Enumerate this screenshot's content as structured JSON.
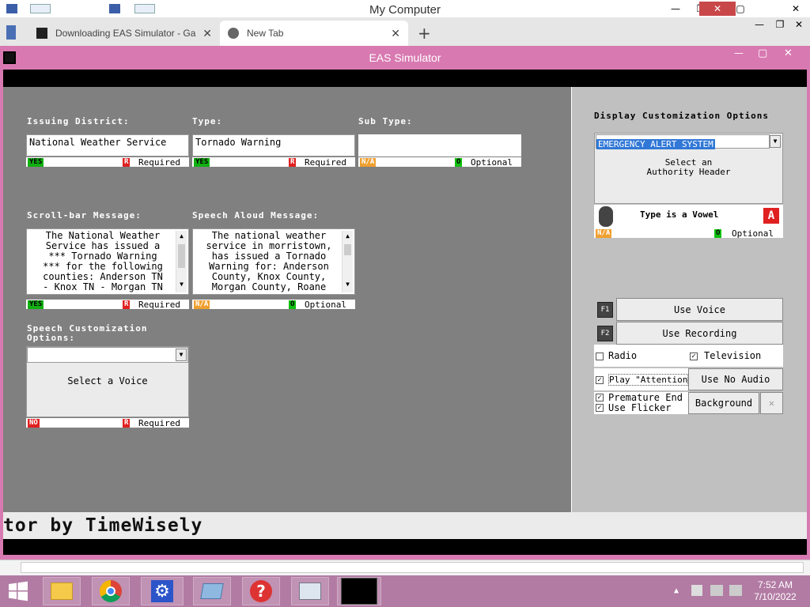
{
  "outer_window": {
    "title": "My Computer"
  },
  "browser": {
    "tabs": [
      {
        "label": "Downloading EAS Simulator - Ga",
        "icon": "download-page-icon"
      },
      {
        "label": "New Tab",
        "icon": "chrome-icon"
      }
    ]
  },
  "app": {
    "title": "EAS Simulator",
    "issuing_district": {
      "label": "Issuing District:",
      "value": "National Weather Service",
      "status": "YES",
      "flag": "R",
      "requirement": "Required"
    },
    "type": {
      "label": "Type:",
      "value": "Tornado Warning",
      "status": "YES",
      "flag": "R",
      "requirement": "Required"
    },
    "sub_type": {
      "label": "Sub Type:",
      "value": "",
      "status": "N/A",
      "flag": "O",
      "requirement": "Optional"
    },
    "scroll_message": {
      "label": "Scroll-bar Message:",
      "lines": [
        "The National Weather",
        "Service has issued a",
        "*** Tornado Warning",
        "*** for the following",
        "counties: Anderson TN",
        "- Knox TN - Morgan TN"
      ],
      "status": "YES",
      "flag": "R",
      "requirement": "Required"
    },
    "speech_message": {
      "label": "Speech Aloud Message:",
      "lines": [
        "The national weather",
        "service in morristown,",
        "has issued a Tornado",
        "Warning for: Anderson",
        "County, Knox County,",
        "Morgan County, Roane"
      ],
      "status": "N/A",
      "flag": "O",
      "requirement": "Optional"
    },
    "speech_options": {
      "label": "Speech Customization Options:",
      "select_value": "",
      "placeholder": "Select a Voice",
      "status": "NO",
      "flag": "R",
      "requirement": "Required"
    },
    "display_options": {
      "label": "Display Customization Options",
      "select_value": "EMERGENCY ALERT SYSTEM",
      "hint_line1": "Select an",
      "hint_line2": "Authority Header",
      "type_vowel": "Type is a Vowel",
      "vowel_letter": "A",
      "status": "N/A",
      "flag": "O",
      "requirement": "Optional"
    },
    "buttons": {
      "f1_key": "F1",
      "use_voice": "Use Voice",
      "f2_key": "F2",
      "use_recording": "Use Recording",
      "use_no_audio": "Use No Audio",
      "background": "Background",
      "close_x": "✕"
    },
    "checkboxes": {
      "radio": {
        "label": "Radio",
        "checked": false
      },
      "television": {
        "label": "Television",
        "checked": true
      },
      "play_attention": {
        "label": "Play \"Attention",
        "checked": true
      },
      "premature_end": {
        "label": "Premature End",
        "checked": true
      },
      "use_flicker": {
        "label": "Use Flicker",
        "checked": true
      }
    },
    "scroll_text": "tor by TimeWisely"
  },
  "taskbar": {
    "time": "7:52 AM",
    "date": "7/10/2022",
    "icons": [
      "start-icon",
      "file-explorer-icon",
      "chrome-icon",
      "settings-icon",
      "window-icon",
      "help-icon",
      "system-monitor-icon",
      "eas-simulator-icon"
    ]
  }
}
